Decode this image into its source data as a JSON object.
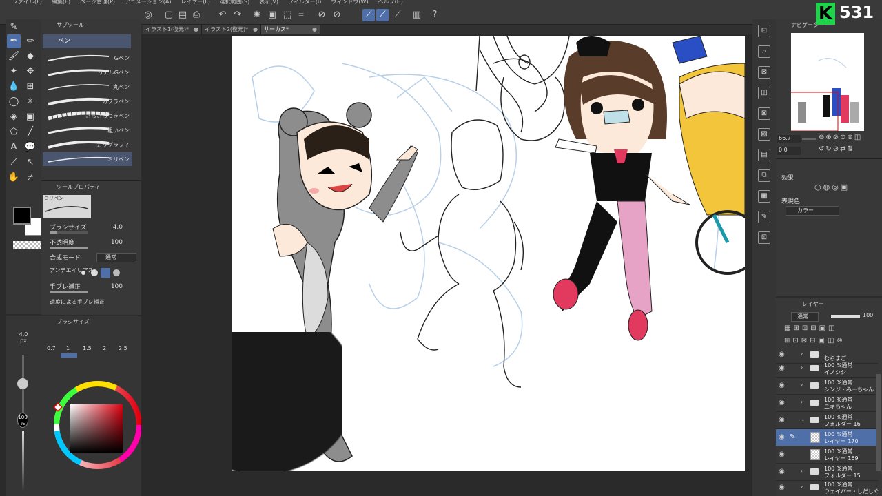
{
  "menu": [
    "ファイル(F)",
    "編集(E)",
    "ページ管理(P)",
    "アニメーション(A)",
    "レイヤー(L)",
    "選択範囲(S)",
    "表示(V)",
    "フィルター(I)",
    "ウィンドウ(W)",
    "ヘルプ(H)"
  ],
  "subtool": {
    "tab": "サブツール",
    "selected": "ペン",
    "brushes": [
      "Gペン",
      "リアルGペン",
      "丸ペン",
      "カブラペン",
      "さらさらつきペン",
      "粗いペン",
      "カリグラフィ",
      "ミリペン"
    ]
  },
  "tool_property": {
    "tab": "ツールプロパティ",
    "preset": "ミリペン",
    "brush_size_label": "ブラシサイズ",
    "brush_size_value": "4.0",
    "opacity_label": "不透明度",
    "opacity_value": "100",
    "blend_label": "合成モード",
    "blend_value": "通常",
    "antialias_label": "アンチエイリアス",
    "stabilizer_label": "手ブレ補正",
    "stabilizer_value": "100",
    "extra_label": "速度による手ブレ補正"
  },
  "brush_size_panel": {
    "tab": "ブラシサイズ",
    "current": "4.0",
    "unit": "px",
    "presets": [
      "0.7",
      "1",
      "1.5",
      "2",
      "2.5"
    ],
    "opacity_label": "100",
    "opacity_unit": "%"
  },
  "doc_tabs": [
    {
      "label": "イラスト1(復元)*",
      "active": false
    },
    {
      "label": "イラスト2(復元)*",
      "active": false
    },
    {
      "label": "サーカス*",
      "active": true
    }
  ],
  "navigator": {
    "tab": "ナビゲーター",
    "zoom": "66.7",
    "rotation": "0.0"
  },
  "effect": {
    "title": "効果",
    "color_label": "表現色",
    "color_value": "カラー"
  },
  "layers": {
    "tab": "レイヤー",
    "blend": "通常",
    "opacity": "100",
    "rows": [
      {
        "l1": "",
        "l2": "むらまご",
        "type": "folder",
        "selected": false
      },
      {
        "l1": "100 %通常",
        "l2": "イノシシ",
        "type": "folder",
        "selected": false
      },
      {
        "l1": "100 %通常",
        "l2": "シンジ・みーちゃん",
        "type": "folder",
        "selected": false
      },
      {
        "l1": "100 %通常",
        "l2": "ユキちゃん",
        "type": "folder",
        "selected": false
      },
      {
        "l1": "100 %通常",
        "l2": "フォルダー 16",
        "type": "folder-open",
        "selected": false
      },
      {
        "l1": "100 %通常",
        "l2": "レイヤー 170",
        "type": "layer",
        "selected": true
      },
      {
        "l1": "100 %通常",
        "l2": "レイヤー 169",
        "type": "layer",
        "selected": false
      },
      {
        "l1": "100 %通常",
        "l2": "フォルダー 15",
        "type": "folder",
        "selected": false
      },
      {
        "l1": "100 %通常",
        "l2": "ウェイバー・しだしぐ",
        "type": "folder",
        "selected": false
      }
    ]
  },
  "stream": {
    "logo": "K",
    "viewers": "531"
  },
  "colors": {
    "accent": "#4e6fa8",
    "logo_green": "#1fd34a"
  }
}
